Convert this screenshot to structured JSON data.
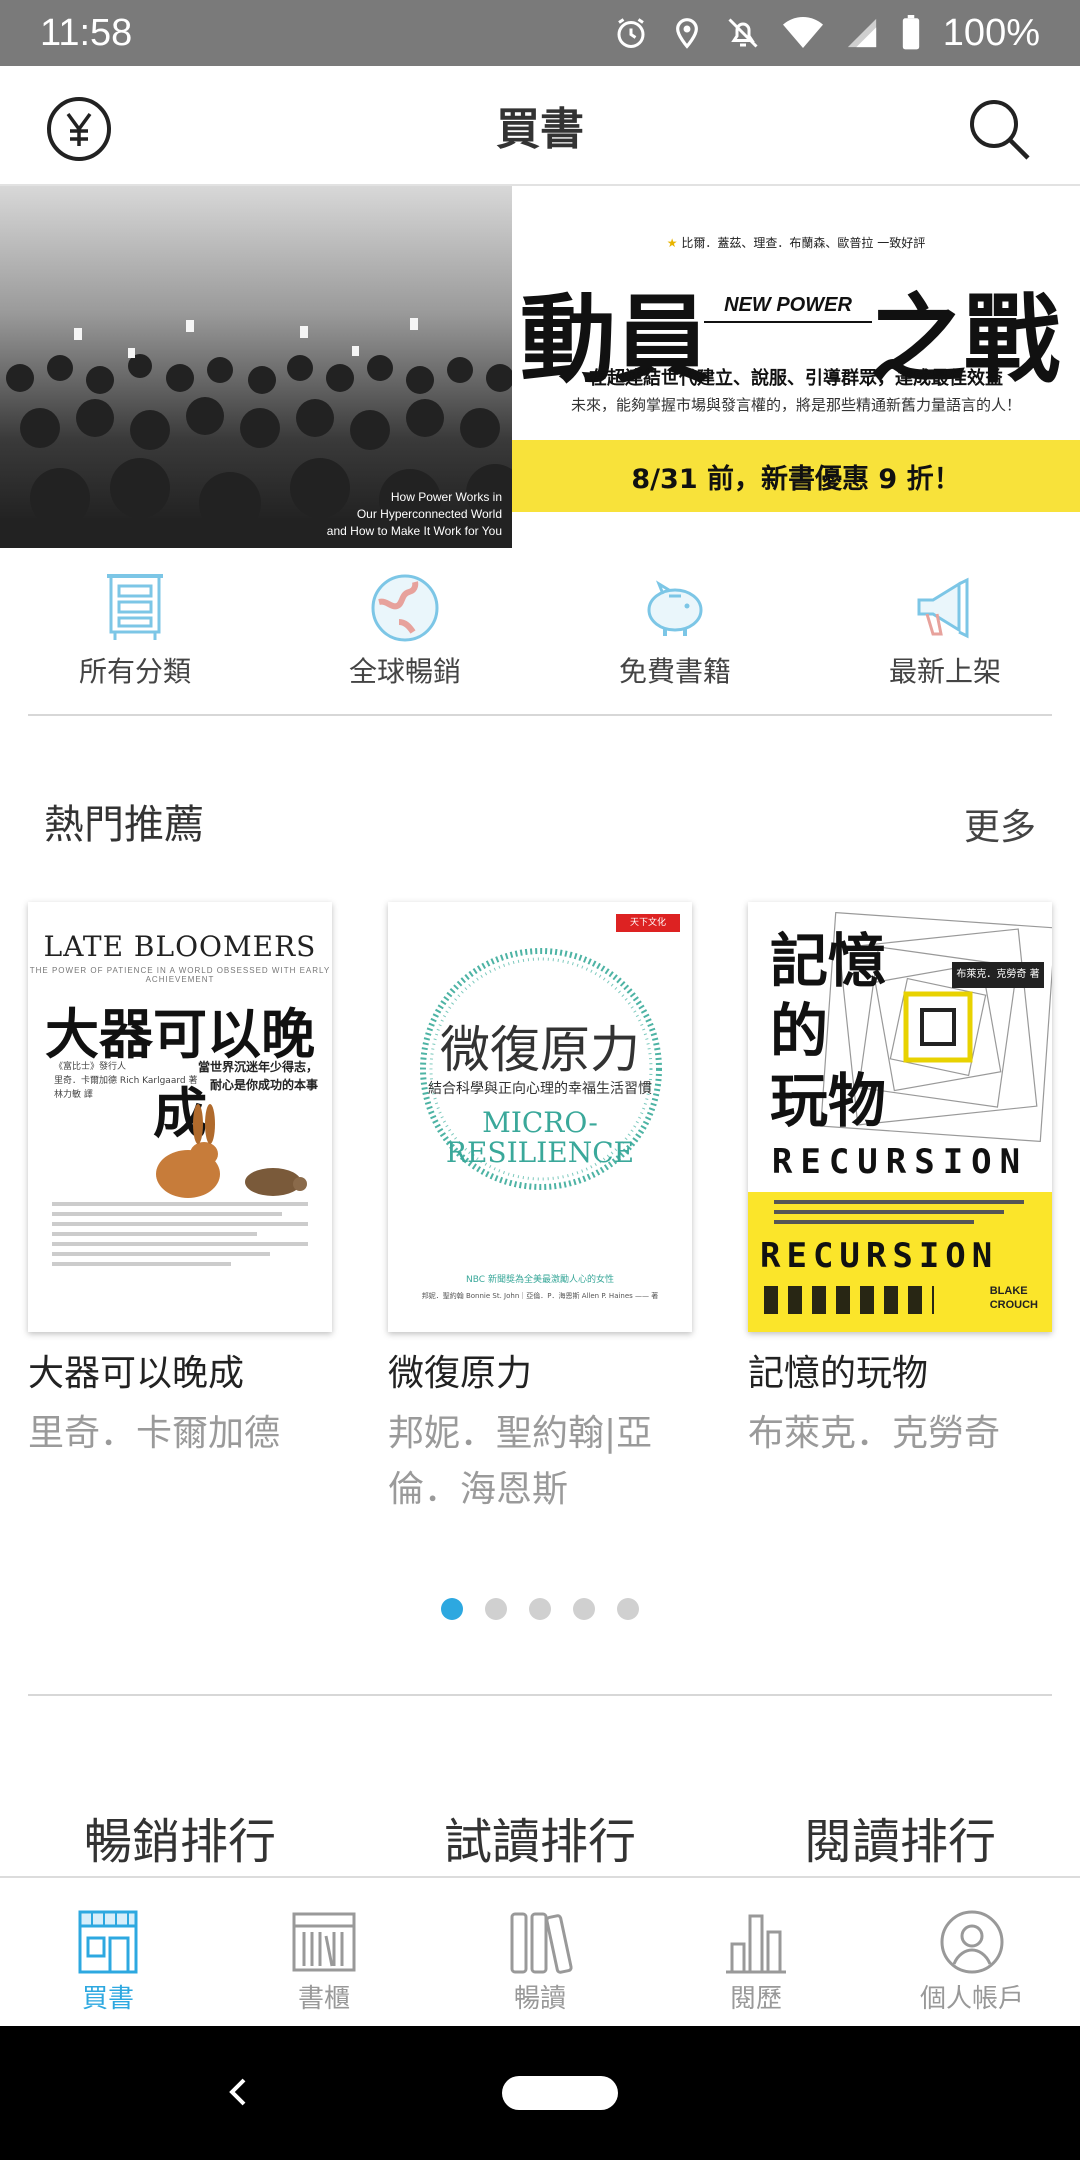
{
  "status_bar": {
    "time": "11:58",
    "battery": "100%"
  },
  "app_bar": {
    "title": "買書",
    "left_icon": "currency-yuan-icon",
    "right_icon": "search-icon"
  },
  "banner": {
    "endorse": "比爾．蓋茲、理查．布蘭森、歐普拉 一致好評",
    "title_part1": "動員",
    "title_mid": "NEW POWER",
    "title_part2": "之戰",
    "subtitle": "在超連結世代建立、說服、引導群眾，達成最佳效益",
    "tagline": "未來，能夠掌握市場與發言權的，將是那些精通新舊力量語言的人！",
    "promo": "8/31 前，新書優惠 9 折！",
    "photo_caption": [
      "How Power Works in",
      "Our Hyperconnected World",
      "and How to Make It Work for You"
    ]
  },
  "categories": [
    {
      "label": "所有分類",
      "icon": "cabinet-icon"
    },
    {
      "label": "全球暢銷",
      "icon": "globe-icon"
    },
    {
      "label": "免費書籍",
      "icon": "piggy-bank-icon"
    },
    {
      "label": "最新上架",
      "icon": "megaphone-icon"
    }
  ],
  "hot": {
    "title": "熱門推薦",
    "more": "更多",
    "books": [
      {
        "title": "大器可以晚成",
        "author": "里奇．卡爾加德",
        "cover": {
          "en_title": "LATE BLOOMERS",
          "en_sub": "THE POWER OF PATIENCE IN A WORLD OBSESSED WITH EARLY ACHIEVEMENT",
          "title": "大器可以晚成",
          "quote": [
            "當世界沉迷年少得志，",
            "耐心是你成功的本事"
          ],
          "author": [
            "《富比士》發行人",
            "里奇．卡爾加德 Rich Karlgaard 著",
            "林力敏 譯"
          ]
        }
      },
      {
        "title": "微復原力",
        "author": "邦妮．聖約翰|亞倫．海恩斯",
        "cover": {
          "logo": "天下文化",
          "title": "微復原力",
          "subtitle": "結合科學與正向心理的幸福生活習慣",
          "en_title_1": "MICRO-",
          "en_title_2": "RESILIENCE",
          "bottom": [
            "NBC 新聞獎為全美最激勵人心的女性",
            "邦妮．聖約翰 Bonnie St. John｜亞倫．P．海恩斯 Allen P. Haines —— 著"
          ]
        }
      },
      {
        "title": "記憶的玩物",
        "author": "布萊克．克勞奇",
        "cover": {
          "title_lines": [
            "記憶",
            "的",
            "玩物"
          ],
          "tag": "布萊克．克勞奇 著",
          "word": "RECURSION",
          "author_en": [
            "BLAKE",
            "CROUCH"
          ]
        }
      }
    ]
  },
  "pager": {
    "count": 5,
    "active": 0
  },
  "rankings": [
    "暢銷排行",
    "試讀排行",
    "閱讀排行"
  ],
  "bottom_nav": [
    {
      "label": "買書",
      "icon": "store-icon",
      "active": true
    },
    {
      "label": "書櫃",
      "icon": "bookshelf-icon",
      "active": false
    },
    {
      "label": "暢讀",
      "icon": "books-icon",
      "active": false
    },
    {
      "label": "閱歷",
      "icon": "bar-chart-icon",
      "active": false
    },
    {
      "label": "個人帳戶",
      "icon": "person-icon",
      "active": false
    }
  ],
  "colors": {
    "accent": "#2da8e0",
    "promo_yellow": "#f8e23a",
    "status_bar": "#7a7a7a"
  }
}
